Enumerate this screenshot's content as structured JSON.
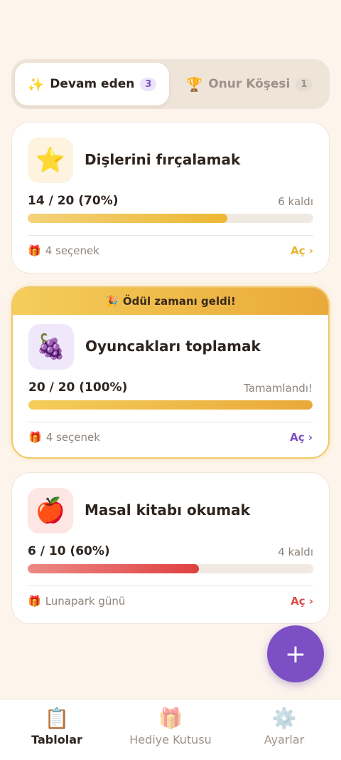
{
  "tabs": [
    {
      "emoji": "✨",
      "label": "Devam eden",
      "count": "3"
    },
    {
      "emoji": "🏆",
      "label": "Onur Köşesi",
      "count": "1"
    }
  ],
  "cards": [
    {
      "icon": "⭐",
      "title": "Dişlerini fırçalamak",
      "progress_text": "14 / 20 (70%)",
      "progress_fraction": 0.7,
      "status": "6 kaldı",
      "reward_icon": "🎁",
      "reward": "4 seçenek",
      "open_label": "Aç ›",
      "accent": "#e5b52f",
      "icon_bg": "#fdf3df"
    },
    {
      "banner_icon": "🎉",
      "banner": "Ödül zamanı geldi!",
      "icon": "🍇",
      "title": "Oyuncakları toplamak",
      "progress_text": "20 / 20 (100%)",
      "progress_fraction": 1.0,
      "status": "Tamamlandı!",
      "reward_icon": "🎁",
      "reward": "4 seçenek",
      "open_label": "Aç ›",
      "accent": "#7a4fc2",
      "icon_bg": "#efe8fb"
    },
    {
      "icon": "🍎",
      "title": "Masal kitabı okumak",
      "progress_text": "6 / 10 (60%)",
      "progress_fraction": 0.6,
      "status": "4 kaldı",
      "reward_icon": "🎁",
      "reward": "Lunapark günü",
      "open_label": "Aç ›",
      "accent": "#e04848",
      "icon_bg": "#fde6e4"
    }
  ],
  "fab": {
    "label": "+"
  },
  "nav": [
    {
      "icon": "📋",
      "label": "Tablolar"
    },
    {
      "icon": "🎁",
      "label": "Hediye Kutusu"
    },
    {
      "icon": "⚙️",
      "label": "Ayarlar"
    }
  ]
}
